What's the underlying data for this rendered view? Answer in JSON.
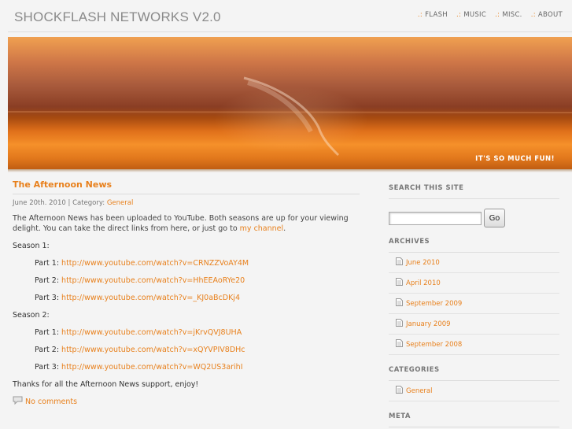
{
  "site": {
    "title": "SHOCKFLASH NETWORKS V2.0"
  },
  "nav": {
    "separator": ".:",
    "items": [
      {
        "label": "FLASH"
      },
      {
        "label": "MUSIC"
      },
      {
        "label": "MISC."
      },
      {
        "label": "ABOUT"
      }
    ]
  },
  "banner": {
    "tagline": "IT'S SO MUCH FUN!"
  },
  "post": {
    "title": "The Afternoon News",
    "date": "June 20th. 2010",
    "category_prefix": " | Category: ",
    "category": "General",
    "intro_1": "The Afternoon News has been uploaded to YouTube. Both seasons are up for your viewing delight. You can take the direct links from here, or just go to ",
    "intro_link": "my channel",
    "intro_end": ".",
    "seasons": [
      {
        "label": "Season 1:",
        "parts": [
          {
            "label": "Part 1: ",
            "url": "http://www.youtube.com/watch?v=CRNZZVoAY4M"
          },
          {
            "label": "Part 2: ",
            "url": "http://www.youtube.com/watch?v=HhEEAoRYe20"
          },
          {
            "label": "Part 3: ",
            "url": "http://www.youtube.com/watch?v=_KJ0aBcDKj4"
          }
        ]
      },
      {
        "label": "Season 2:",
        "parts": [
          {
            "label": "Part 1: ",
            "url": "http://www.youtube.com/watch?v=jKrvQVJ8UHA"
          },
          {
            "label": "Part 2: ",
            "url": "http://www.youtube.com/watch?v=xQYVPIV8DHc"
          },
          {
            "label": "Part 3: ",
            "url": "http://www.youtube.com/watch?v=WQ2US3arihI"
          }
        ]
      }
    ],
    "thanks": "Thanks for all the Afternoon News support, enjoy!",
    "comments": "No comments"
  },
  "sidebar": {
    "search": {
      "title": "SEARCH THIS SITE",
      "value": "",
      "button": "Go"
    },
    "archives": {
      "title": "ARCHIVES",
      "items": [
        "June 2010",
        "April 2010",
        "September 2009",
        "January 2009",
        "September 2008"
      ]
    },
    "categories": {
      "title": "CATEGORIES",
      "items": [
        "General"
      ]
    },
    "meta": {
      "title": "META"
    }
  },
  "colors": {
    "accent": "#e8801c",
    "text": "#333333",
    "background": "#f4f4f4"
  },
  "icons": {
    "list_bullet": "page-icon",
    "comments": "comment-bubble-icon"
  }
}
